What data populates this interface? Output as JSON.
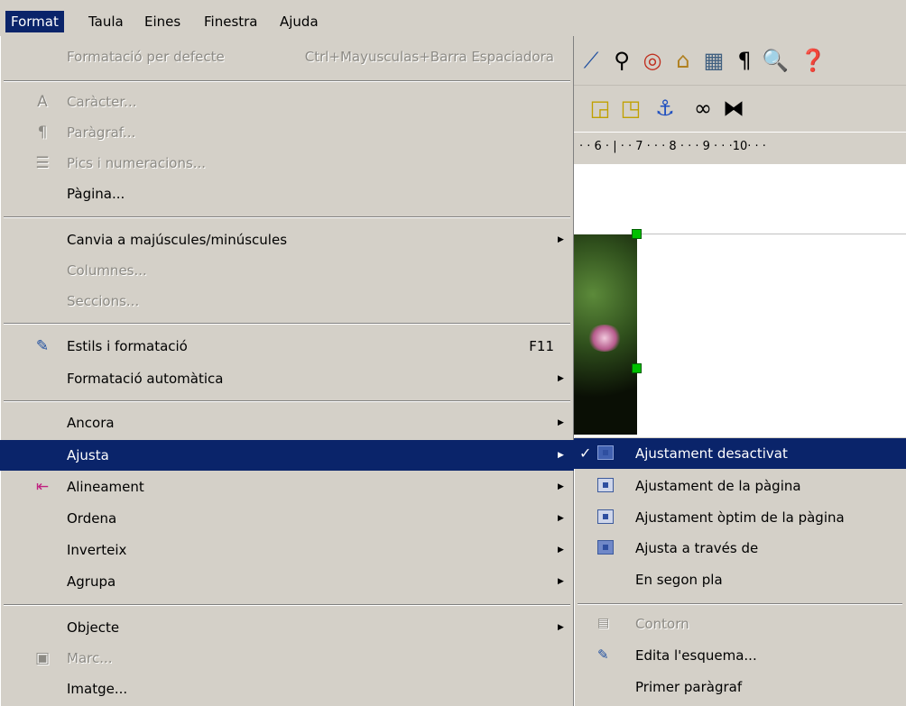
{
  "menubar": {
    "items": [
      "Format",
      "Taula",
      "Eines",
      "Finestra",
      "Ajuda"
    ],
    "active": "Format"
  },
  "ruler": {
    "text": "· · 6 · | · · 7 · · · 8 · · · 9 · · ·10· · ·"
  },
  "format_menu": {
    "items": [
      {
        "label": "Formatació per defecte",
        "shortcut": "Ctrl+Mayusculas+Barra Espaciadora",
        "disabled": true
      },
      {
        "label": "Caràcter...",
        "icon": "character-icon",
        "disabled": true
      },
      {
        "label": "Paràgraf...",
        "icon": "paragraph-icon",
        "disabled": true
      },
      {
        "label": "Pics i numeracions...",
        "icon": "bullets-icon",
        "disabled": true
      },
      {
        "label": "Pàgina..."
      },
      {
        "label": "Canvia a majúscules/minúscules",
        "submenu": true
      },
      {
        "label": "Columnes...",
        "disabled": true
      },
      {
        "label": "Seccions...",
        "disabled": true
      },
      {
        "label": "Estils i formatació",
        "shortcut": "F11",
        "icon": "styles-icon"
      },
      {
        "label": "Formatació automàtica",
        "submenu": true
      },
      {
        "label": "Ancora",
        "submenu": true
      },
      {
        "label": "Ajusta",
        "submenu": true,
        "highlighted": true
      },
      {
        "label": "Alineament",
        "submenu": true,
        "icon": "alignment-icon"
      },
      {
        "label": "Ordena",
        "submenu": true
      },
      {
        "label": "Inverteix",
        "submenu": true
      },
      {
        "label": "Agrupa",
        "submenu": true
      },
      {
        "label": "Objecte",
        "submenu": true
      },
      {
        "label": "Marc...",
        "icon": "frame-icon",
        "disabled": true
      },
      {
        "label": "Imatge..."
      }
    ]
  },
  "wrap_menu": {
    "items": [
      {
        "label": "Ajustament desactivat",
        "checked": true,
        "highlighted": true
      },
      {
        "label": "Ajustament de la pàgina"
      },
      {
        "label": "Ajustament òptim de la pàgina"
      },
      {
        "label": "Ajusta a través de"
      },
      {
        "label": "En segon pla"
      },
      {
        "label": "Contorn",
        "disabled": true
      },
      {
        "label": "Edita l'esquema..."
      },
      {
        "label": "Primer paràgraf"
      }
    ]
  },
  "colors": {
    "highlight": "#0a246a",
    "menu_bg": "#d4d0c8",
    "disabled_text": "#8c8a84"
  }
}
